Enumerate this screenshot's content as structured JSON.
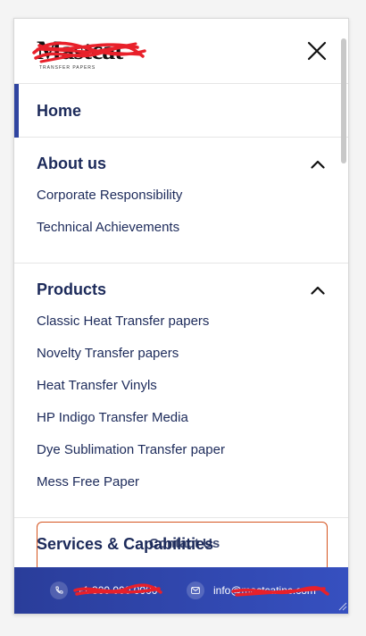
{
  "header": {
    "logo_text": "Mastcat",
    "logo_sub": "TRANSFER PAPERS"
  },
  "menu": {
    "home_label": "Home",
    "about": {
      "title": "About us",
      "items": [
        "Corporate Responsibility",
        "Technical Achievements"
      ]
    },
    "products": {
      "title": "Products",
      "items": [
        "Classic Heat Transfer papers",
        "Novelty Transfer papers",
        "Heat Transfer Vinyls",
        "HP Indigo Transfer Media",
        "Dye Sublimation Transfer paper",
        "Mess Free Paper"
      ]
    },
    "services_label": "Services & Capabilities",
    "services_ghost": "Contact Us"
  },
  "footer": {
    "phone_text": "+1 800 000 0000",
    "email_text": "info@mastcatinc.com"
  },
  "colors": {
    "accent": "#2f44a0",
    "text": "#1c2a5a",
    "button_border": "#d5541f",
    "footer_bg": "#3650c0",
    "redaction": "#e8202a"
  },
  "icons": {
    "close": "close-icon",
    "chevron": "chevron-up-icon",
    "phone": "phone-icon",
    "mail": "mail-icon"
  }
}
